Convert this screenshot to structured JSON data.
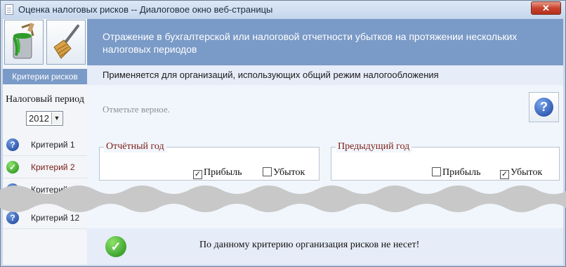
{
  "window": {
    "title": "Оценка налоговых рисков -- Диалоговое окно веб-страницы",
    "close_label": "✕"
  },
  "left": {
    "toolbar": {
      "paint_icon": "paint-bucket-icon",
      "broom_icon": "broom-icon"
    },
    "criteria_header": "Критерии рисков",
    "period_label": "Налоговый период",
    "year_select": {
      "value": "2012"
    },
    "criteria": [
      {
        "label": "Критерий 1",
        "status_icon": "question-icon"
      },
      {
        "label": "Критерий 2",
        "status_icon": "check-icon"
      },
      {
        "label": "Критерий",
        "status_icon": "question-icon"
      },
      {
        "label": "Критерий 12",
        "status_icon": "question-icon"
      }
    ]
  },
  "main": {
    "banner": "Отражение в бухгалтерской или налоговой отчетности убытков на протяжении нескольких налоговых периодов",
    "subtitle": "Применяется для организаций, использующих общий режим налогообложения",
    "hint": "Отметьте верное.",
    "help_icon": "help-question-icon",
    "groups": [
      {
        "legend": "Отчётный год",
        "options": [
          {
            "label": "Прибыль",
            "checked": true
          },
          {
            "label": "Убыток",
            "checked": false
          }
        ]
      },
      {
        "legend": "Предыдущий год",
        "options": [
          {
            "label": "Прибыль",
            "checked": false
          },
          {
            "label": "Убыток",
            "checked": true
          }
        ]
      }
    ],
    "footer_icon": "check-icon",
    "footer_text": "По данному критерию организация рисков не несет!"
  },
  "colors": {
    "banner": "#7a9ac7",
    "criteria_active_label": "#7a1b14",
    "legend": "#7a1b14",
    "check_green": "#1e8a19",
    "question_blue": "#1a3f9a"
  }
}
